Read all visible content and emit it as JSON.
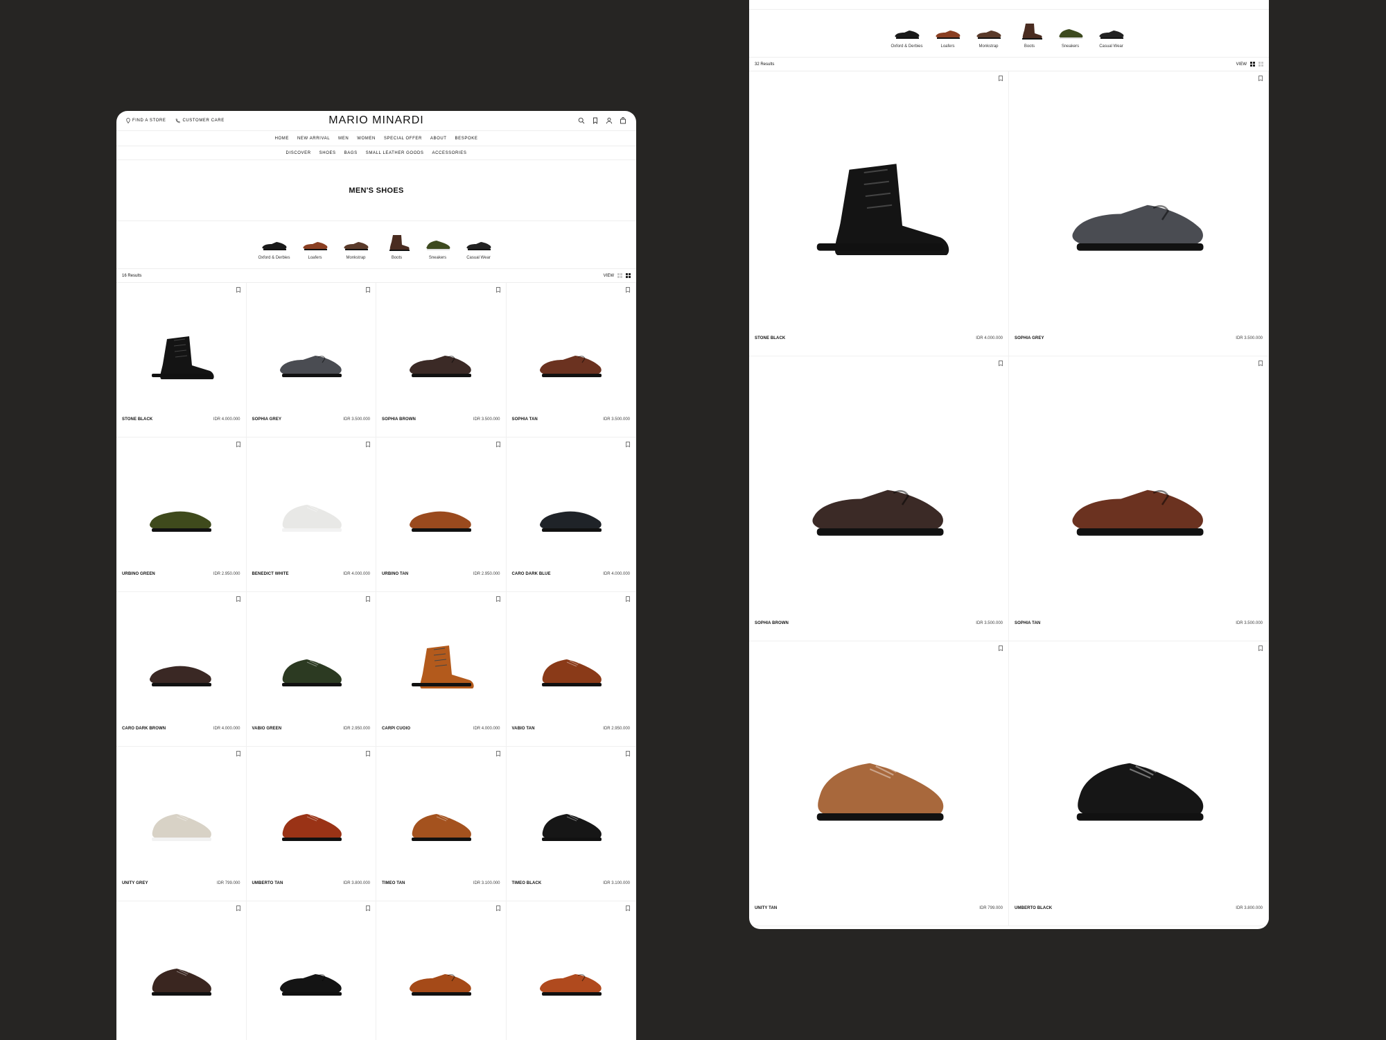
{
  "brand": "MARIO MINARDI",
  "top_links": {
    "find_store": "FIND A STORE",
    "customer_care": "CUSTOMER CARE"
  },
  "nav": [
    "HOME",
    "NEW ARRIVAL",
    "MEN",
    "WOMEN",
    "SPECIAL OFFER",
    "ABOUT",
    "BESPOKE"
  ],
  "subnav": [
    "DISCOVER",
    "SHOES",
    "BAGS",
    "SMALL LEATHER GOODS",
    "ACCESSORIES"
  ],
  "page_title": "MEN'S SHOES",
  "categories": [
    {
      "label": "Oxford & Derbies",
      "color": "#1a1a1a",
      "kind": "low"
    },
    {
      "label": "Loafers",
      "color": "#8a3f22",
      "kind": "low"
    },
    {
      "label": "Monkstrap",
      "color": "#5a3a2a",
      "kind": "low"
    },
    {
      "label": "Boots",
      "color": "#4a2c20",
      "kind": "boot"
    },
    {
      "label": "Sneakers",
      "color": "#3d4a1f",
      "kind": "sneaker"
    },
    {
      "label": "Casual Wear",
      "color": "#222222",
      "kind": "low"
    }
  ],
  "left": {
    "results": "16 Results",
    "view_label": "VIEW",
    "products": [
      {
        "name": "STONE BLACK",
        "price": "IDR 4.000.000",
        "color": "#141414",
        "kind": "boot"
      },
      {
        "name": "SOPHIA GREY",
        "price": "IDR 3.500.000",
        "color": "#4a4c52",
        "kind": "loafer"
      },
      {
        "name": "SOPHIA BROWN",
        "price": "IDR 3.500.000",
        "color": "#3b2a26",
        "kind": "loafer"
      },
      {
        "name": "SOPHIA TAN",
        "price": "IDR 3.500.000",
        "color": "#6b3220",
        "kind": "loafer"
      },
      {
        "name": "URBINO GREEN",
        "price": "IDR 2.950.000",
        "color": "#3f4a1c",
        "kind": "slipon"
      },
      {
        "name": "BENEDICT WHITE",
        "price": "IDR 4.000.000",
        "color": "#e8e8e6",
        "kind": "sneaker"
      },
      {
        "name": "URBINO TAN",
        "price": "IDR 2.950.000",
        "color": "#9a4a1e",
        "kind": "slipon"
      },
      {
        "name": "CARO DARK BLUE",
        "price": "IDR 4.000.000",
        "color": "#1f2328",
        "kind": "slipon"
      },
      {
        "name": "CARO DARK BROWN",
        "price": "IDR 4.000.000",
        "color": "#3a2824",
        "kind": "slipon"
      },
      {
        "name": "VABIO GREEN",
        "price": "IDR 2.950.000",
        "color": "#2c3a22",
        "kind": "sneaker"
      },
      {
        "name": "CARPI CUOIO",
        "price": "IDR 4.000.000",
        "color": "#b35a1c",
        "kind": "boot"
      },
      {
        "name": "VABIO TAN",
        "price": "IDR 2.950.000",
        "color": "#8a3a18",
        "kind": "sneaker"
      },
      {
        "name": "UNITY GREY",
        "price": "IDR 799.000",
        "color": "#d8d2c6",
        "kind": "sneaker"
      },
      {
        "name": "UMBERTO TAN",
        "price": "IDR 3.800.000",
        "color": "#9a3316",
        "kind": "sneaker"
      },
      {
        "name": "TIMEO TAN",
        "price": "IDR 3.100.000",
        "color": "#a4521e",
        "kind": "sneaker"
      },
      {
        "name": "TIMEO BLACK",
        "price": "IDR 3.100.000",
        "color": "#161616",
        "kind": "sneaker"
      },
      {
        "name": "",
        "price": "",
        "color": "#3a2620",
        "kind": "sneaker"
      },
      {
        "name": "",
        "price": "",
        "color": "#141414",
        "kind": "loafer"
      },
      {
        "name": "",
        "price": "",
        "color": "#a54a18",
        "kind": "loafer"
      },
      {
        "name": "",
        "price": "",
        "color": "#b04a1e",
        "kind": "loafer"
      }
    ]
  },
  "right": {
    "results": "32 Results",
    "view_label": "VIEW",
    "products": [
      {
        "name": "STONE BLACK",
        "price": "IDR 4.000.000",
        "color": "#141414",
        "kind": "boot"
      },
      {
        "name": "SOPHIA GREY",
        "price": "IDR 3.500.000",
        "color": "#4a4c52",
        "kind": "loafer"
      },
      {
        "name": "SOPHIA BROWN",
        "price": "IDR 3.500.000",
        "color": "#3b2a26",
        "kind": "loafer"
      },
      {
        "name": "SOPHIA TAN",
        "price": "IDR 3.500.000",
        "color": "#6b3220",
        "kind": "loafer"
      },
      {
        "name": "UNITY TAN",
        "price": "IDR 799.000",
        "color": "#a8683c",
        "kind": "sneaker"
      },
      {
        "name": "UMBERTO BLACK",
        "price": "IDR 3.800.000",
        "color": "#161616",
        "kind": "sneaker"
      }
    ]
  }
}
